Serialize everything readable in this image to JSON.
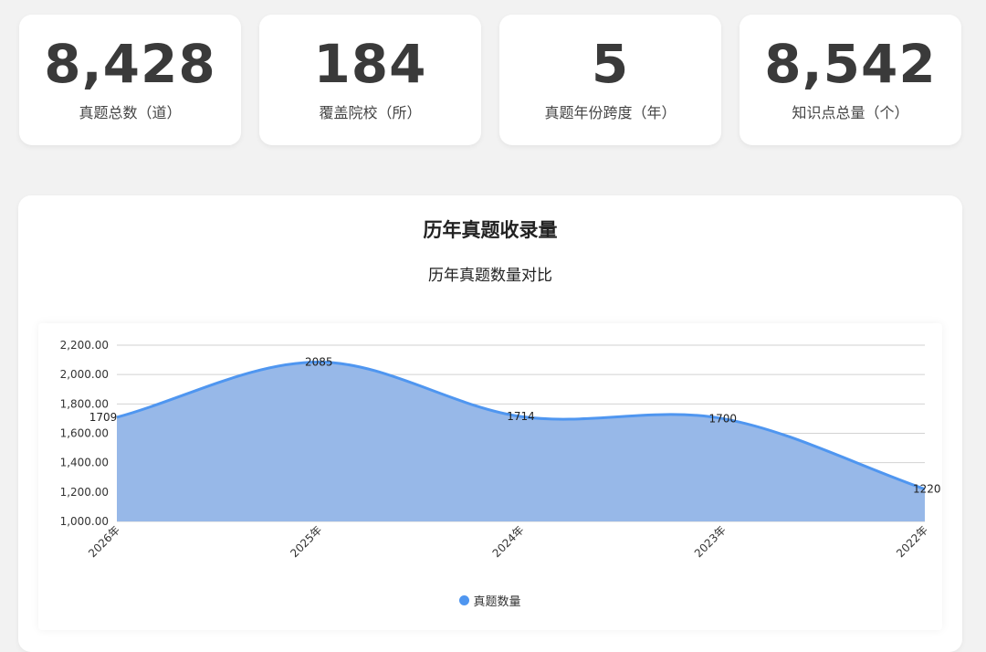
{
  "stats": [
    {
      "value": "8,428",
      "label": "真题总数（道）"
    },
    {
      "value": "184",
      "label": "覆盖院校（所）"
    },
    {
      "value": "5",
      "label": "真题年份跨度（年）"
    },
    {
      "value": "8,542",
      "label": "知识点总量（个）"
    }
  ],
  "card_title": "历年真题收录量",
  "colors": {
    "line": "#4f96f0",
    "fill": "#97b8e8"
  },
  "chart_data": {
    "type": "area",
    "title": "历年真题数量对比",
    "categories": [
      "2026年",
      "2025年",
      "2024年",
      "2023年",
      "2022年"
    ],
    "series": [
      {
        "name": "真题数量",
        "values": [
          1709,
          2085,
          1714,
          1700,
          1220
        ]
      }
    ],
    "value_labels": [
      "1709",
      "2085",
      "1714",
      "1700",
      "1220"
    ],
    "ylim": [
      1000,
      2200
    ],
    "yticks": [
      1000,
      1200,
      1400,
      1600,
      1800,
      2000,
      2200
    ],
    "ytick_labels": [
      "1,000.00",
      "1,200.00",
      "1,400.00",
      "1,600.00",
      "1,800.00",
      "2,000.00",
      "2,200.00"
    ],
    "grid": true,
    "legend_position": "bottom",
    "xlabel": "",
    "ylabel": ""
  }
}
